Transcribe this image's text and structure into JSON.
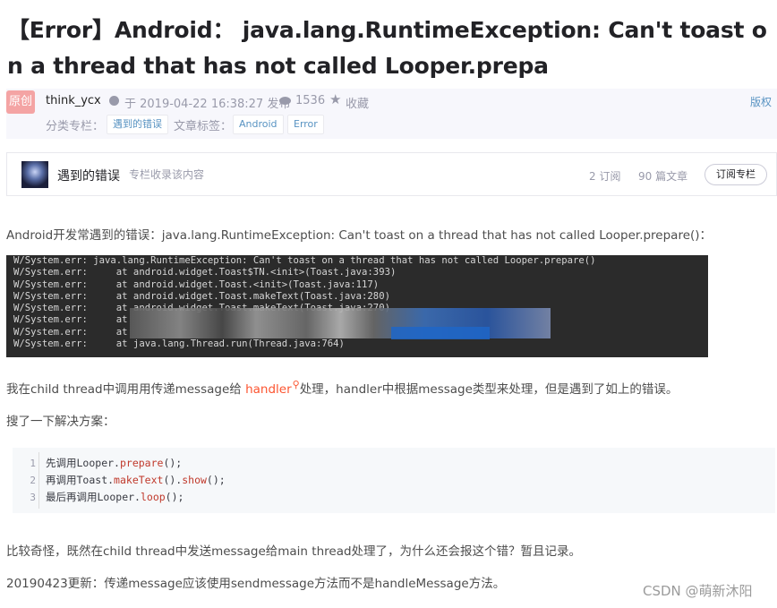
{
  "article": {
    "title": "【Error】Android： java.lang.RuntimeException: Can't toast on a thread that has not called Looper.prepa"
  },
  "meta": {
    "original_badge": "原创",
    "author": "think_ycx",
    "published": "于 2019-04-22 16:38:27 发布",
    "views": "1536",
    "favorite": "收藏",
    "copyright": "版权",
    "category_label": "分类专栏：",
    "category": "遇到的错误",
    "tags_label": "文章标签：",
    "tags": [
      "Android",
      "Error"
    ]
  },
  "column": {
    "title": "遇到的错误",
    "subtitle": "专栏收录该内容",
    "subscriptions": "2 订阅",
    "articles": "90 篇文章",
    "subscribe_button": "订阅专栏"
  },
  "body": {
    "p1": "Android开发常遇到的错误：java.lang.RuntimeException: Can't toast on a thread that has not called Looper.prepare()：",
    "p2_before": "我在child thread中调用用传递message给 ",
    "p2_link": "handler",
    "p2_after": "处理，handler中根据message类型来处理，但是遇到了如上的错误。",
    "p3": "搜了一下解决方案：",
    "p4": "比较奇怪，既然在child thread中发送message给main thread处理了，为什么还会报这个错？暂且记录。",
    "p5": "20190423更新：传递message应该使用sendmessage方法而不是handleMessage方法。"
  },
  "terminal_lines": [
    "W/System.err: java.lang.RuntimeException: Can't toast on a thread that has not called Looper.prepare()",
    "W/System.err:     at android.widget.Toast$TN.<init>(Toast.java:393)",
    "W/System.err:     at android.widget.Toast.<init>(Toast.java:117)",
    "W/System.err:     at android.widget.Toast.makeText(Toast.java:280)",
    "W/System.err:     at android.widget.Toast.makeText(Toast.java:270)",
    "W/System.err:     at",
    "W/System.err:     at",
    "W/System.err:     at java.lang.Thread.run(Thread.java:764)"
  ],
  "code": [
    {
      "num": "1",
      "prefix": "先调用Looper.",
      "method": "prepare",
      "suffix": "();"
    },
    {
      "num": "2",
      "prefix": "再调用Toast.",
      "method": "makeText",
      "mid": "().",
      "method2": "show",
      "suffix": "();"
    },
    {
      "num": "3",
      "prefix": "最后再调用Looper.",
      "method": "loop",
      "suffix": "();"
    }
  ],
  "watermark": "CSDN @萌新沐阳",
  "colors": {
    "link": "#fc5531",
    "tag": "#5893c2",
    "muted": "#999aaa",
    "terminal_bg": "#2b2b2b",
    "code_bg": "#f6f8fa"
  }
}
